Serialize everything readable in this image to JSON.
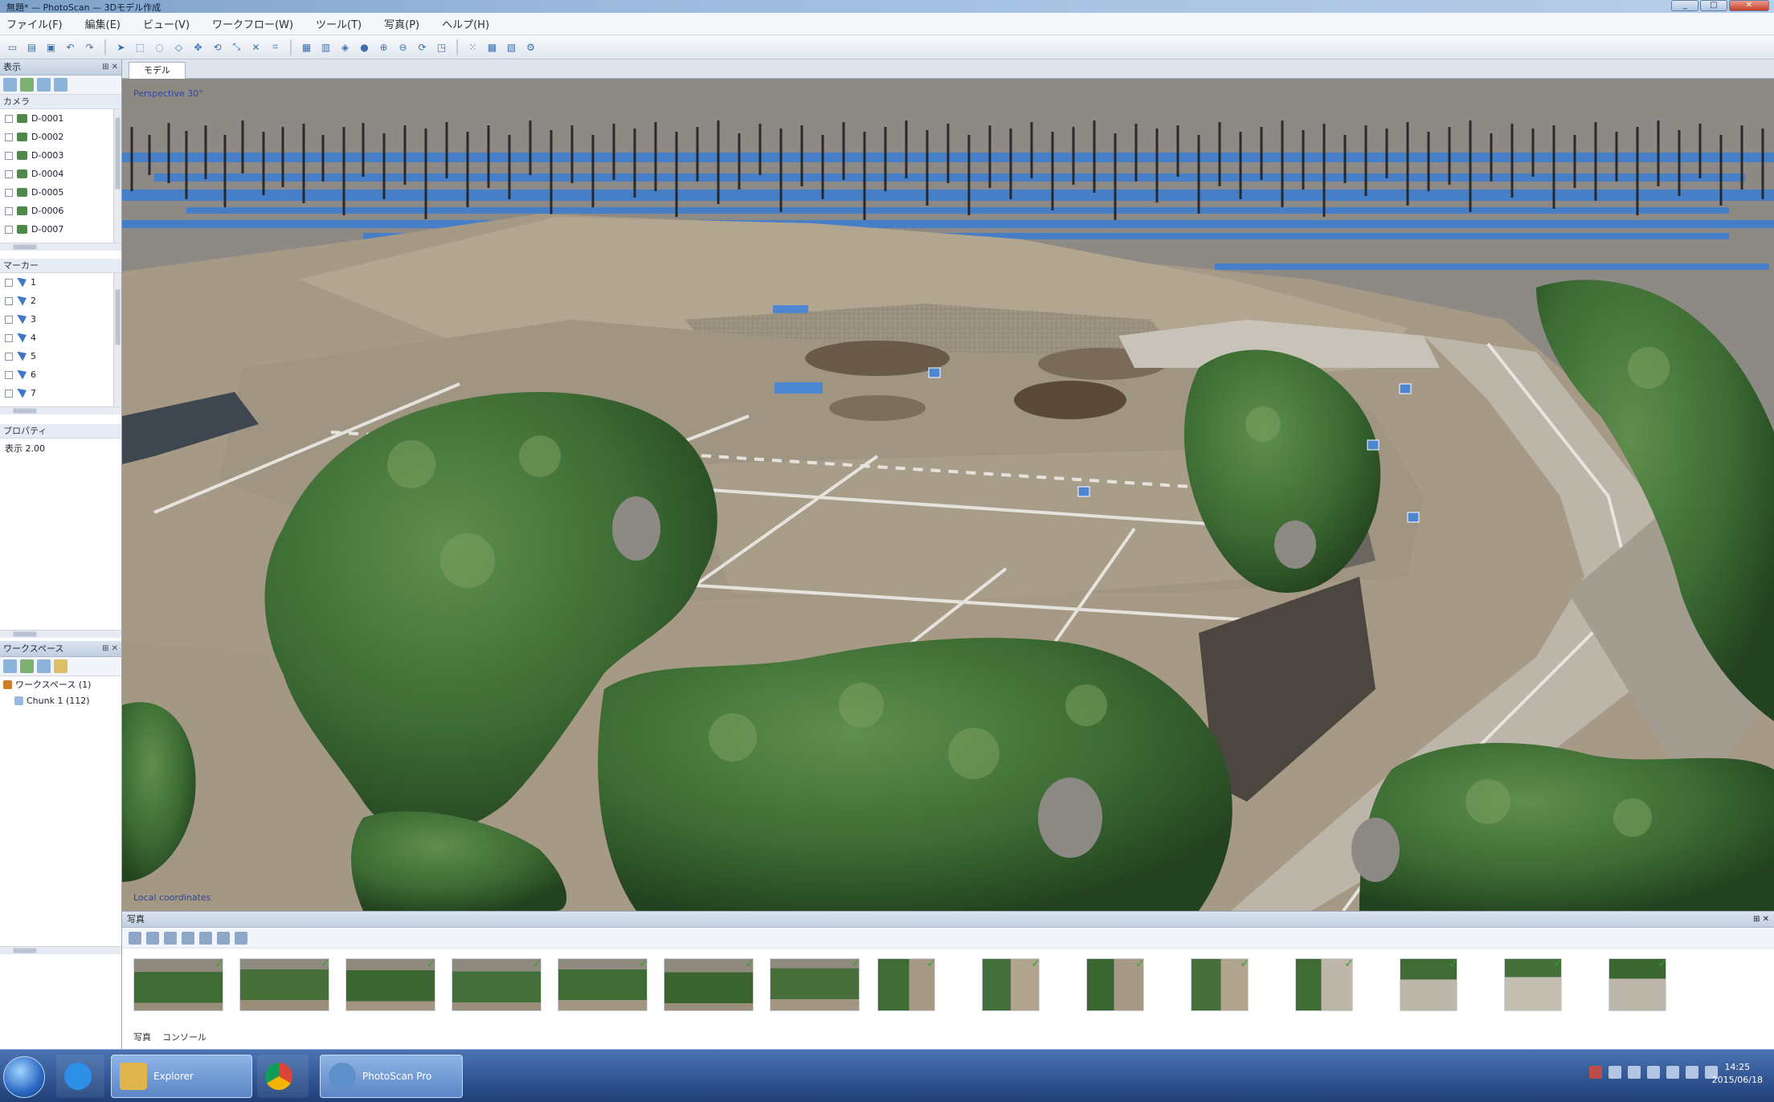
{
  "window": {
    "title": "無題* — PhotoScan — 3Dモデル作成"
  },
  "menu": [
    "ファイル(F)",
    "編集(E)",
    "ビュー(V)",
    "ワークフロー(W)",
    "ツール(T)",
    "写真(P)",
    "ヘルプ(H)"
  ],
  "left": {
    "workspace_title": "表示",
    "cameras_header": "カメラ",
    "cameras": [
      "D-0001",
      "D-0002",
      "D-0003",
      "D-0004",
      "D-0005",
      "D-0006",
      "D-0007"
    ],
    "markers_header": "マーカー",
    "markers": [
      "1",
      "2",
      "3",
      "4",
      "5",
      "6",
      "7"
    ],
    "props_header": "プロパティ",
    "props_value": "表示 2.00",
    "tree_title": "ワークスペース",
    "tree": [
      "ワークスペース (1)",
      "Chunk 1 (112)"
    ]
  },
  "viewport": {
    "tab": "モデル",
    "corner_label": "Perspective 30°",
    "bottom_label": "Local coordinates"
  },
  "photos": {
    "title": "写真",
    "count": 16,
    "footer": [
      "写真",
      "コンソール"
    ]
  },
  "taskbar": {
    "buttons": [
      "Explorer",
      "Chrome",
      "PhotoScan Pro"
    ],
    "time": "14:25",
    "date": "2015/06/18"
  },
  "colors": {
    "sky": "#8d8984",
    "water": "#3f7fcf",
    "tree": "#3c6b33",
    "accent": "#2b68c4"
  }
}
